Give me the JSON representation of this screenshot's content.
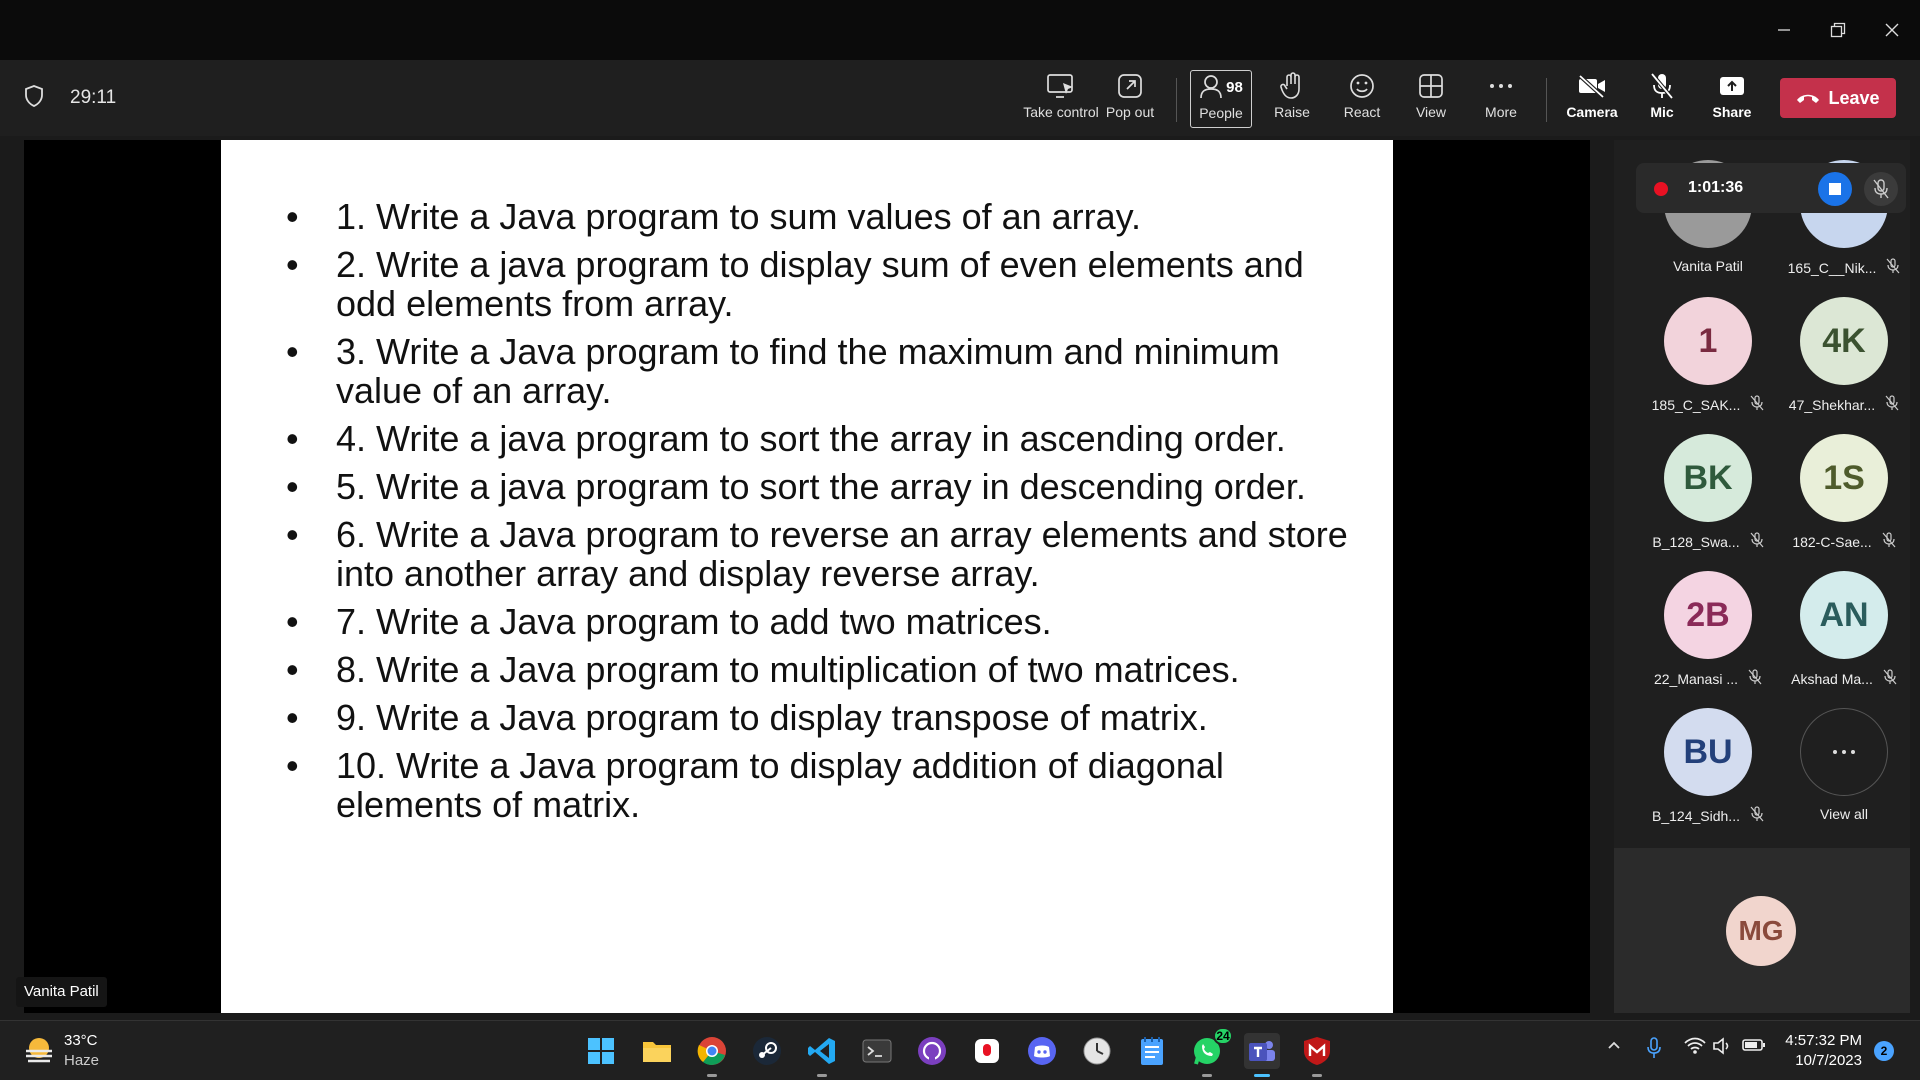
{
  "meeting": {
    "duration": "29:11",
    "recording_time": "1:01:36",
    "people_count": "98"
  },
  "toolbar": {
    "take_control": "Take control",
    "pop_out": "Pop out",
    "people": "People",
    "raise": "Raise",
    "react": "React",
    "view": "View",
    "more": "More",
    "camera": "Camera",
    "mic": "Mic",
    "share": "Share",
    "leave": "Leave"
  },
  "slide": {
    "items": [
      "1. Write a Java program to sum values of an array.",
      "2. Write a java program to display sum of even elements and odd elements from array.",
      "3. Write a Java program to find the maximum and minimum value of an array.",
      "4. Write a java program to sort the array in ascending order.",
      "5. Write a java program to sort the array in descending order.",
      "6. Write a Java program to reverse an array elements and store into another array and display reverse array.",
      "7. Write a Java program to add two matrices.",
      "8. Write a Java program to multiplication of two matrices.",
      "9. Write a Java program to display transpose of matrix.",
      "10. Write a Java program to display addition of diagonal elements of matrix."
    ]
  },
  "presenter_name": "Vanita Patil",
  "participants": [
    {
      "initials": "",
      "name": "Vanita Patil",
      "muted": false,
      "bg": "#9a9a9a",
      "fg": "#333333"
    },
    {
      "initials": "",
      "name": "165_C__Nik...",
      "muted": true,
      "bg": "#c7d6ee",
      "fg": "#2a3f6b"
    },
    {
      "initials": "1",
      "name": "185_C_SAK...",
      "muted": true,
      "bg": "#f2d3db",
      "fg": "#7a2a40"
    },
    {
      "initials": "4K",
      "name": "47_Shekhar...",
      "muted": true,
      "bg": "#dce7d5",
      "fg": "#3b5230"
    },
    {
      "initials": "BK",
      "name": "B_128_Swa...",
      "muted": true,
      "bg": "#d6eadb",
      "fg": "#2f5a3c"
    },
    {
      "initials": "1S",
      "name": "182-C-Sae...",
      "muted": true,
      "bg": "#e9efd9",
      "fg": "#4e5b2b"
    },
    {
      "initials": "2B",
      "name": "22_Manasi ...",
      "muted": true,
      "bg": "#f4d4e2",
      "fg": "#8a2a58"
    },
    {
      "initials": "AN",
      "name": "Akshad Ma...",
      "muted": true,
      "bg": "#d4ecec",
      "fg": "#2a5c5c"
    },
    {
      "initials": "BU",
      "name": "B_124_Sidh...",
      "muted": true,
      "bg": "#d3dcef",
      "fg": "#23407a"
    }
  ],
  "view_all": "View all",
  "self_initials": "MG",
  "taskbar": {
    "temperature": "33°C",
    "weather": "Haze",
    "time": "4:57:32 PM",
    "date": "10/7/2023",
    "whatsapp_badge": "24",
    "notifications": "2"
  }
}
